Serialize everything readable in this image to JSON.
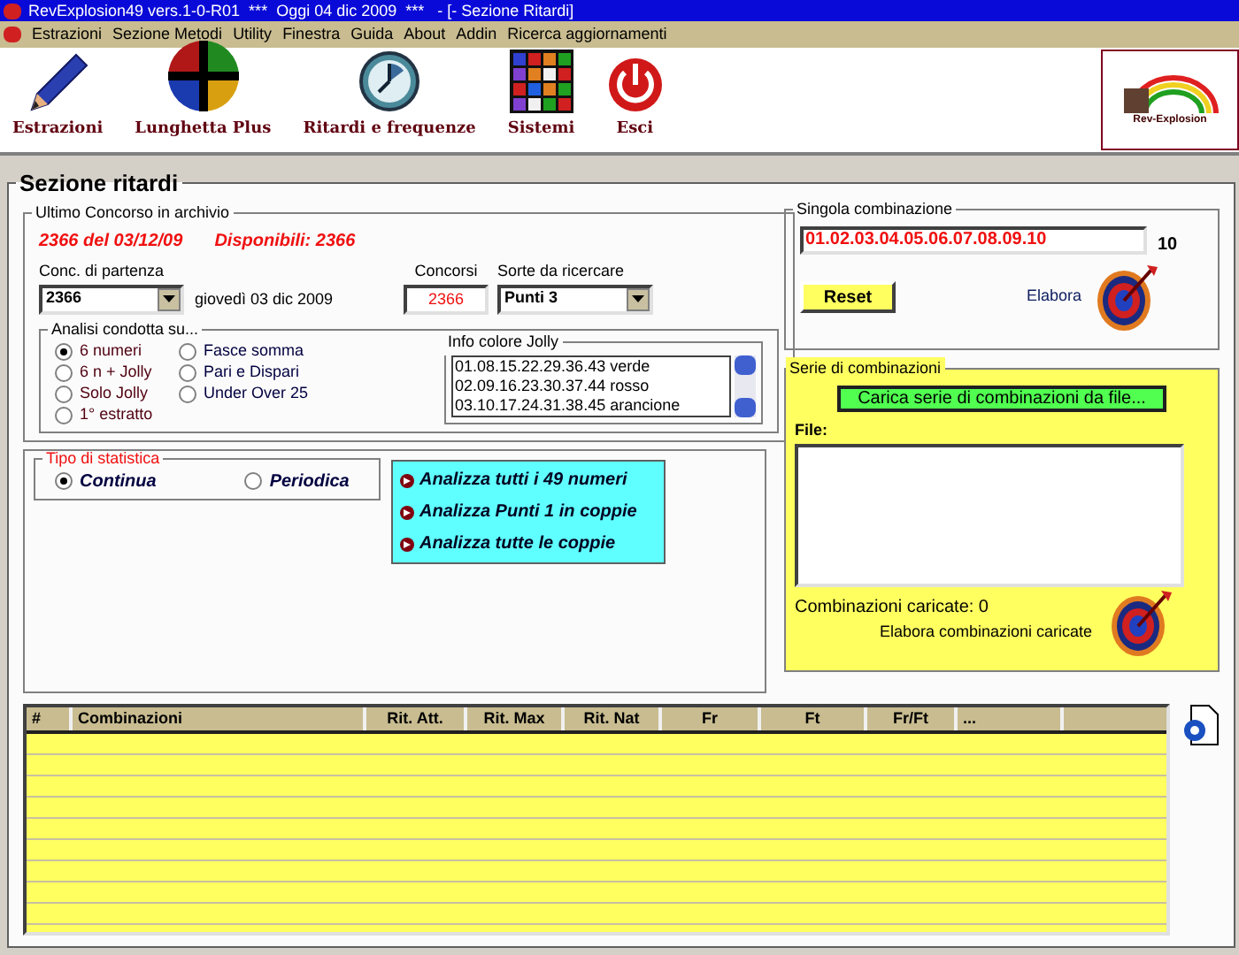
{
  "window": {
    "title": "RevExplosion49 vers.1-0-R01  ***  Oggi 04 dic 2009  ***   - [- Sezione Ritardi]"
  },
  "menu": [
    "Estrazioni",
    "Sezione Metodi",
    "Utility",
    "Finestra",
    "Guida",
    "About",
    "Addin",
    "Ricerca aggiornamenti"
  ],
  "toolbar": [
    {
      "kind": "pencil",
      "label": "Estrazioni"
    },
    {
      "kind": "quadrants",
      "label": "Lunghetta Plus"
    },
    {
      "kind": "clock",
      "label": "Ritardi e frequenze"
    },
    {
      "kind": "grid",
      "label": "Sistemi"
    },
    {
      "kind": "power",
      "label": "Esci"
    }
  ],
  "logo": {
    "text": "Rev-Explosion"
  },
  "section": {
    "title": "Sezione ritardi"
  },
  "ultimo": {
    "title": "Ultimo Concorso in archivio",
    "concorso": "2366 del 03/12/09",
    "disponibili": "Disponibili: 2366",
    "partenza_label": "Conc. di partenza",
    "partenza_value": "2366",
    "date": "giovedì 03 dic 2009",
    "concorsi_label": "Concorsi",
    "concorsi_value": "2366",
    "sorte_label": "Sorte da ricercare",
    "sorte_value": "Punti 3"
  },
  "analisi": {
    "title": "Analisi condotta su...",
    "options": [
      {
        "label": "6 numeri",
        "selected": true
      },
      {
        "label": "6 n + Jolly",
        "selected": false
      },
      {
        "label": "Solo Jolly",
        "selected": false
      },
      {
        "label": "1° estratto",
        "selected": false
      },
      {
        "label": "Fasce somma",
        "selected": false
      },
      {
        "label": "Pari e Dispari",
        "selected": false
      },
      {
        "label": "Under Over 25",
        "selected": false
      }
    ]
  },
  "jolly": {
    "title": "Info colore Jolly",
    "items": [
      "01.08.15.22.29.36.43 verde",
      "02.09.16.23.30.37.44 rosso",
      "03.10.17.24.31.38.45 arancione"
    ]
  },
  "tipo": {
    "title": "Tipo di statistica",
    "options": [
      {
        "label": "Continua",
        "selected": true
      },
      {
        "label": "Periodica",
        "selected": false
      }
    ]
  },
  "actions": [
    "Analizza tutti i 49 numeri",
    "Analizza Punti 1 in coppie",
    "Analizza tutte le coppie"
  ],
  "singola": {
    "title": "Singola combinazione",
    "value": "01.02.03.04.05.06.07.08.09.10",
    "count": "10",
    "reset": "Reset",
    "elabora": "Elabora"
  },
  "serie": {
    "title": "Serie di combinazioni",
    "load": "Carica serie di combinazioni da file...",
    "file_label": "File:",
    "loaded": "Combinazioni caricate: 0",
    "elabora": "Elabora combinazioni caricate"
  },
  "table": {
    "columns": [
      "#",
      "Combinazioni",
      "Rit. Att.",
      "Rit. Max",
      "Rit. Nat",
      "Fr",
      "Ft",
      "Fr/Ft",
      "..."
    ]
  }
}
